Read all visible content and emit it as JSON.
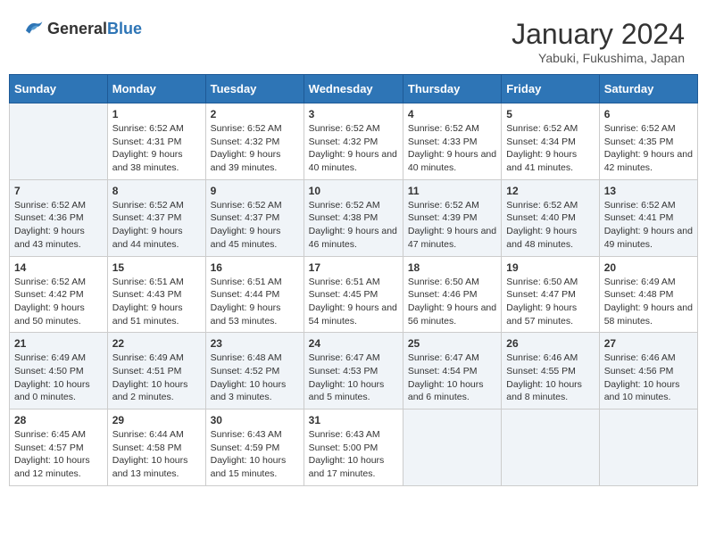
{
  "header": {
    "logo_general": "General",
    "logo_blue": "Blue",
    "main_title": "January 2024",
    "subtitle": "Yabuki, Fukushima, Japan"
  },
  "calendar": {
    "days_of_week": [
      "Sunday",
      "Monday",
      "Tuesday",
      "Wednesday",
      "Thursday",
      "Friday",
      "Saturday"
    ],
    "weeks": [
      [
        {
          "day": "",
          "sunrise": "",
          "sunset": "",
          "daylight": ""
        },
        {
          "day": "1",
          "sunrise": "Sunrise: 6:52 AM",
          "sunset": "Sunset: 4:31 PM",
          "daylight": "Daylight: 9 hours and 38 minutes."
        },
        {
          "day": "2",
          "sunrise": "Sunrise: 6:52 AM",
          "sunset": "Sunset: 4:32 PM",
          "daylight": "Daylight: 9 hours and 39 minutes."
        },
        {
          "day": "3",
          "sunrise": "Sunrise: 6:52 AM",
          "sunset": "Sunset: 4:32 PM",
          "daylight": "Daylight: 9 hours and 40 minutes."
        },
        {
          "day": "4",
          "sunrise": "Sunrise: 6:52 AM",
          "sunset": "Sunset: 4:33 PM",
          "daylight": "Daylight: 9 hours and 40 minutes."
        },
        {
          "day": "5",
          "sunrise": "Sunrise: 6:52 AM",
          "sunset": "Sunset: 4:34 PM",
          "daylight": "Daylight: 9 hours and 41 minutes."
        },
        {
          "day": "6",
          "sunrise": "Sunrise: 6:52 AM",
          "sunset": "Sunset: 4:35 PM",
          "daylight": "Daylight: 9 hours and 42 minutes."
        }
      ],
      [
        {
          "day": "7",
          "sunrise": "Sunrise: 6:52 AM",
          "sunset": "Sunset: 4:36 PM",
          "daylight": "Daylight: 9 hours and 43 minutes."
        },
        {
          "day": "8",
          "sunrise": "Sunrise: 6:52 AM",
          "sunset": "Sunset: 4:37 PM",
          "daylight": "Daylight: 9 hours and 44 minutes."
        },
        {
          "day": "9",
          "sunrise": "Sunrise: 6:52 AM",
          "sunset": "Sunset: 4:37 PM",
          "daylight": "Daylight: 9 hours and 45 minutes."
        },
        {
          "day": "10",
          "sunrise": "Sunrise: 6:52 AM",
          "sunset": "Sunset: 4:38 PM",
          "daylight": "Daylight: 9 hours and 46 minutes."
        },
        {
          "day": "11",
          "sunrise": "Sunrise: 6:52 AM",
          "sunset": "Sunset: 4:39 PM",
          "daylight": "Daylight: 9 hours and 47 minutes."
        },
        {
          "day": "12",
          "sunrise": "Sunrise: 6:52 AM",
          "sunset": "Sunset: 4:40 PM",
          "daylight": "Daylight: 9 hours and 48 minutes."
        },
        {
          "day": "13",
          "sunrise": "Sunrise: 6:52 AM",
          "sunset": "Sunset: 4:41 PM",
          "daylight": "Daylight: 9 hours and 49 minutes."
        }
      ],
      [
        {
          "day": "14",
          "sunrise": "Sunrise: 6:52 AM",
          "sunset": "Sunset: 4:42 PM",
          "daylight": "Daylight: 9 hours and 50 minutes."
        },
        {
          "day": "15",
          "sunrise": "Sunrise: 6:51 AM",
          "sunset": "Sunset: 4:43 PM",
          "daylight": "Daylight: 9 hours and 51 minutes."
        },
        {
          "day": "16",
          "sunrise": "Sunrise: 6:51 AM",
          "sunset": "Sunset: 4:44 PM",
          "daylight": "Daylight: 9 hours and 53 minutes."
        },
        {
          "day": "17",
          "sunrise": "Sunrise: 6:51 AM",
          "sunset": "Sunset: 4:45 PM",
          "daylight": "Daylight: 9 hours and 54 minutes."
        },
        {
          "day": "18",
          "sunrise": "Sunrise: 6:50 AM",
          "sunset": "Sunset: 4:46 PM",
          "daylight": "Daylight: 9 hours and 56 minutes."
        },
        {
          "day": "19",
          "sunrise": "Sunrise: 6:50 AM",
          "sunset": "Sunset: 4:47 PM",
          "daylight": "Daylight: 9 hours and 57 minutes."
        },
        {
          "day": "20",
          "sunrise": "Sunrise: 6:49 AM",
          "sunset": "Sunset: 4:48 PM",
          "daylight": "Daylight: 9 hours and 58 minutes."
        }
      ],
      [
        {
          "day": "21",
          "sunrise": "Sunrise: 6:49 AM",
          "sunset": "Sunset: 4:50 PM",
          "daylight": "Daylight: 10 hours and 0 minutes."
        },
        {
          "day": "22",
          "sunrise": "Sunrise: 6:49 AM",
          "sunset": "Sunset: 4:51 PM",
          "daylight": "Daylight: 10 hours and 2 minutes."
        },
        {
          "day": "23",
          "sunrise": "Sunrise: 6:48 AM",
          "sunset": "Sunset: 4:52 PM",
          "daylight": "Daylight: 10 hours and 3 minutes."
        },
        {
          "day": "24",
          "sunrise": "Sunrise: 6:47 AM",
          "sunset": "Sunset: 4:53 PM",
          "daylight": "Daylight: 10 hours and 5 minutes."
        },
        {
          "day": "25",
          "sunrise": "Sunrise: 6:47 AM",
          "sunset": "Sunset: 4:54 PM",
          "daylight": "Daylight: 10 hours and 6 minutes."
        },
        {
          "day": "26",
          "sunrise": "Sunrise: 6:46 AM",
          "sunset": "Sunset: 4:55 PM",
          "daylight": "Daylight: 10 hours and 8 minutes."
        },
        {
          "day": "27",
          "sunrise": "Sunrise: 6:46 AM",
          "sunset": "Sunset: 4:56 PM",
          "daylight": "Daylight: 10 hours and 10 minutes."
        }
      ],
      [
        {
          "day": "28",
          "sunrise": "Sunrise: 6:45 AM",
          "sunset": "Sunset: 4:57 PM",
          "daylight": "Daylight: 10 hours and 12 minutes."
        },
        {
          "day": "29",
          "sunrise": "Sunrise: 6:44 AM",
          "sunset": "Sunset: 4:58 PM",
          "daylight": "Daylight: 10 hours and 13 minutes."
        },
        {
          "day": "30",
          "sunrise": "Sunrise: 6:43 AM",
          "sunset": "Sunset: 4:59 PM",
          "daylight": "Daylight: 10 hours and 15 minutes."
        },
        {
          "day": "31",
          "sunrise": "Sunrise: 6:43 AM",
          "sunset": "Sunset: 5:00 PM",
          "daylight": "Daylight: 10 hours and 17 minutes."
        },
        {
          "day": "",
          "sunrise": "",
          "sunset": "",
          "daylight": ""
        },
        {
          "day": "",
          "sunrise": "",
          "sunset": "",
          "daylight": ""
        },
        {
          "day": "",
          "sunrise": "",
          "sunset": "",
          "daylight": ""
        }
      ]
    ]
  }
}
